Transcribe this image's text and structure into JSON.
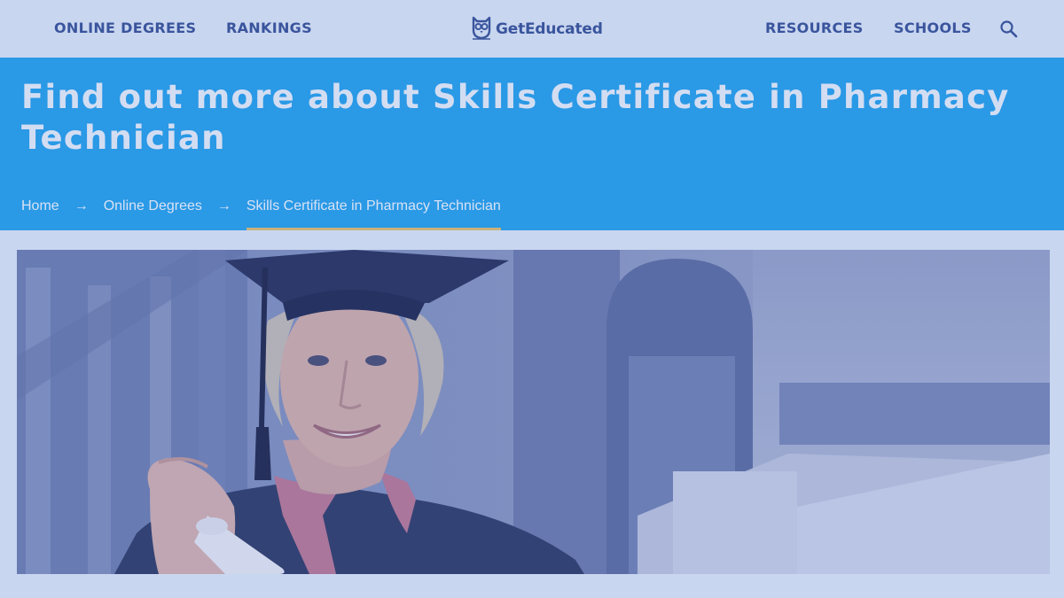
{
  "nav": {
    "left_links": [
      "ONLINE DEGREES",
      "RANKINGS"
    ],
    "right_links": [
      "RESOURCES",
      "SCHOOLS"
    ],
    "logo_text": "GetEducated",
    "logo_icon": "owl-logo-icon",
    "search_icon": "search-icon"
  },
  "hero": {
    "title": "Find out more about Skills Certificate in Pharmacy Technician",
    "breadcrumb": [
      "Home",
      "Online Degrees",
      "Skills Certificate in Pharmacy Technician"
    ],
    "breadcrumb_separator": "→"
  },
  "photo": {
    "subject": "woman-in-graduation-cap-holding-diploma-icon"
  },
  "colors": {
    "nav_background": "#c9d6f0",
    "nav_text": "#3a559d",
    "hero_background": "#2a99e6",
    "hero_text": "#d3ddf2",
    "breadcrumb_underline": "#c9b27a"
  }
}
